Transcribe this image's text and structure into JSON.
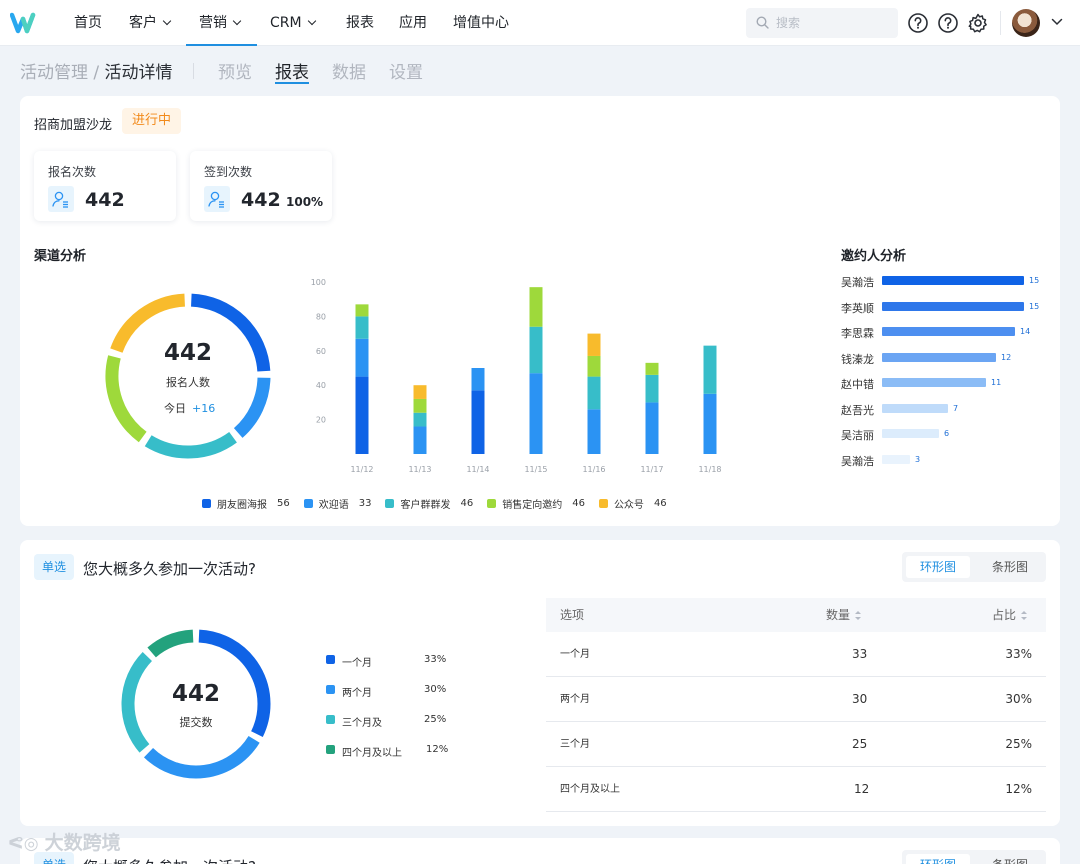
{
  "nav": {
    "items": [
      {
        "label": "首页",
        "caret": false
      },
      {
        "label": "客户",
        "caret": true
      },
      {
        "label": "营销",
        "caret": true,
        "active": true
      },
      {
        "label": "CRM",
        "caret": true
      },
      {
        "label": "报表",
        "caret": false
      },
      {
        "label": "应用",
        "caret": false
      },
      {
        "label": "增值中心",
        "caret": false
      }
    ],
    "search_placeholder": "搜索",
    "icons": [
      "help-icon",
      "help-icon",
      "gear-icon"
    ]
  },
  "breadcrumb": {
    "parent": "活动管理",
    "sep": " / ",
    "current": "活动详情"
  },
  "subtabs": [
    {
      "label": "预览"
    },
    {
      "label": "报表",
      "active": true
    },
    {
      "label": "数据"
    },
    {
      "label": "设置"
    }
  ],
  "event": {
    "name": "招商加盟沙龙",
    "status": "进行中"
  },
  "stats": {
    "signup": {
      "label": "报名次数",
      "value": "442"
    },
    "checkin": {
      "label": "签到次数",
      "value": "442",
      "pct": "100%"
    }
  },
  "channel": {
    "title": "渠道分析",
    "donut": {
      "total": "442",
      "label": "报名人数",
      "today_label": "今日",
      "today_value": "+16"
    }
  },
  "colors": {
    "c1": "#0f63e6",
    "c2": "#2b93f3",
    "c3": "#37bdc9",
    "c4": "#9ed93b",
    "c5": "#f8bb2c",
    "q4": "#23a27d"
  },
  "chart_data": [
    {
      "type": "pie",
      "title": "渠道分析",
      "labels": [
        "朋友圈海报",
        "欢迎语",
        "客户群群发",
        "销售定向邀约",
        "公众号"
      ],
      "values": [
        56,
        33,
        46,
        46,
        46
      ]
    },
    {
      "type": "bar",
      "stacked": true,
      "categories": [
        "11/12",
        "11/13",
        "11/14",
        "11/15",
        "11/16",
        "11/17",
        "11/18"
      ],
      "ylim": [
        0,
        100
      ],
      "yticks": [
        20,
        40,
        60,
        80,
        100
      ],
      "grid": false,
      "legend": "bottom",
      "series": [
        {
          "name": "朋友圈海报",
          "values": [
            45,
            0,
            37,
            0,
            0,
            0,
            0
          ]
        },
        {
          "name": "欢迎语",
          "values": [
            22,
            16,
            13,
            47,
            26,
            30,
            35
          ]
        },
        {
          "name": "客户群群发",
          "values": [
            13,
            8,
            0,
            27,
            19,
            16,
            28
          ]
        },
        {
          "name": "销售定向邀约",
          "values": [
            7,
            8,
            0,
            23,
            12,
            7,
            0
          ]
        },
        {
          "name": "公众号",
          "values": [
            0,
            8,
            0,
            0,
            13,
            0,
            0
          ]
        }
      ],
      "legend_values": [
        56,
        33,
        46,
        46,
        46
      ]
    },
    {
      "type": "bar",
      "orientation": "horizontal",
      "title": "邀约人分析",
      "categories": [
        "吴瀚浩",
        "李英顺",
        "李思霖",
        "钱溱龙",
        "赵中错",
        "赵吾光",
        "吴洁丽",
        "吴瀚浩"
      ],
      "values": [
        15,
        15,
        14,
        12,
        11,
        7,
        6,
        3
      ]
    },
    {
      "type": "pie",
      "labels": [
        "一个月",
        "两个月",
        "三个月及",
        "四个月及以上"
      ],
      "values": [
        33,
        30,
        25,
        12
      ]
    }
  ],
  "question": {
    "type_badge": "单选",
    "text": "您大概多久参加一次活动?",
    "view_ring": "环形图",
    "view_bar": "条形图",
    "donut_total": "442",
    "donut_label": "提交数",
    "legend": [
      {
        "label": "一个月",
        "pct": "33%"
      },
      {
        "label": "两个月",
        "pct": "30%"
      },
      {
        "label": "三个月及",
        "pct": "25%"
      },
      {
        "label": "四个月及以上",
        "pct": "12%"
      }
    ],
    "table": {
      "headers": [
        "选项",
        "数量",
        "占比"
      ],
      "rows": [
        [
          "一个月",
          "33",
          "33%"
        ],
        [
          "两个月",
          "30",
          "30%"
        ],
        [
          "三个月",
          "25",
          "25%"
        ],
        [
          "四个月及以上",
          "12",
          "12%"
        ]
      ]
    }
  },
  "question2": {
    "type_badge": "单选",
    "text": "您大概多久参加一次活动?",
    "view_ring": "环形图",
    "view_bar": "条形图"
  },
  "watermark": "大数跨境"
}
